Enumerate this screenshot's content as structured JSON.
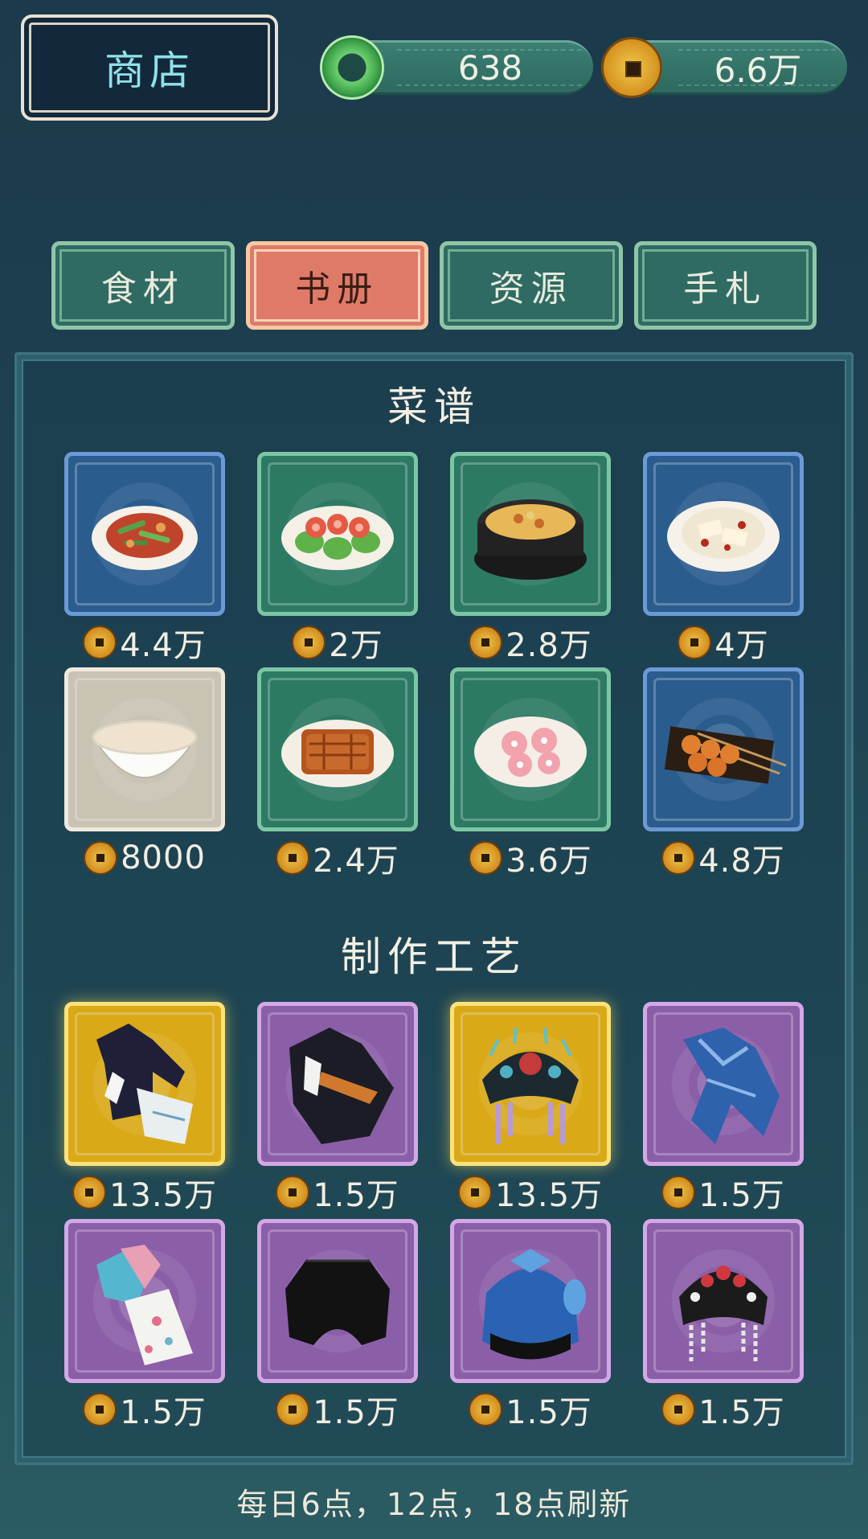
{
  "header": {
    "title": "商店",
    "jade_amount": "638",
    "coin_amount": "6.6万"
  },
  "tabs": [
    {
      "label": "食材",
      "active": false
    },
    {
      "label": "书册",
      "active": true
    },
    {
      "label": "资源",
      "active": false
    },
    {
      "label": "手札",
      "active": false
    }
  ],
  "recipes": {
    "title": "菜谱",
    "items": [
      {
        "icon": "stir-fry-dish-icon",
        "rarity": "blue",
        "price": "4.4万"
      },
      {
        "icon": "shrimp-dish-icon",
        "rarity": "green",
        "price": "2万"
      },
      {
        "icon": "claypot-rice-icon",
        "rarity": "green",
        "price": "2.8万"
      },
      {
        "icon": "spicy-tofu-dish-icon",
        "rarity": "blue",
        "price": "4万"
      },
      {
        "icon": "soup-bowl-icon",
        "rarity": "white",
        "price": "8000"
      },
      {
        "icon": "glazed-cake-icon",
        "rarity": "green",
        "price": "2.4万"
      },
      {
        "icon": "flower-pastry-icon",
        "rarity": "green",
        "price": "3.6万"
      },
      {
        "icon": "skewers-icon",
        "rarity": "blue",
        "price": "4.8万"
      }
    ]
  },
  "crafts": {
    "title": "制作工艺",
    "items": [
      {
        "icon": "hanfu-robe-icon",
        "rarity": "gold",
        "price": "13.5万"
      },
      {
        "icon": "dark-robe-icon",
        "rarity": "purple",
        "price": "1.5万"
      },
      {
        "icon": "phoenix-crown-icon",
        "rarity": "gold",
        "price": "13.5万"
      },
      {
        "icon": "blue-garment-icon",
        "rarity": "purple",
        "price": "1.5万"
      },
      {
        "icon": "embroidered-dress-icon",
        "rarity": "purple",
        "price": "1.5万"
      },
      {
        "icon": "black-hat-icon",
        "rarity": "purple",
        "price": "1.5万"
      },
      {
        "icon": "blue-headdress-icon",
        "rarity": "purple",
        "price": "1.5万"
      },
      {
        "icon": "opera-headdress-icon",
        "rarity": "purple",
        "price": "1.5万"
      }
    ]
  },
  "footer": {
    "refresh_note": "每日6点，12点，18点刷新"
  }
}
